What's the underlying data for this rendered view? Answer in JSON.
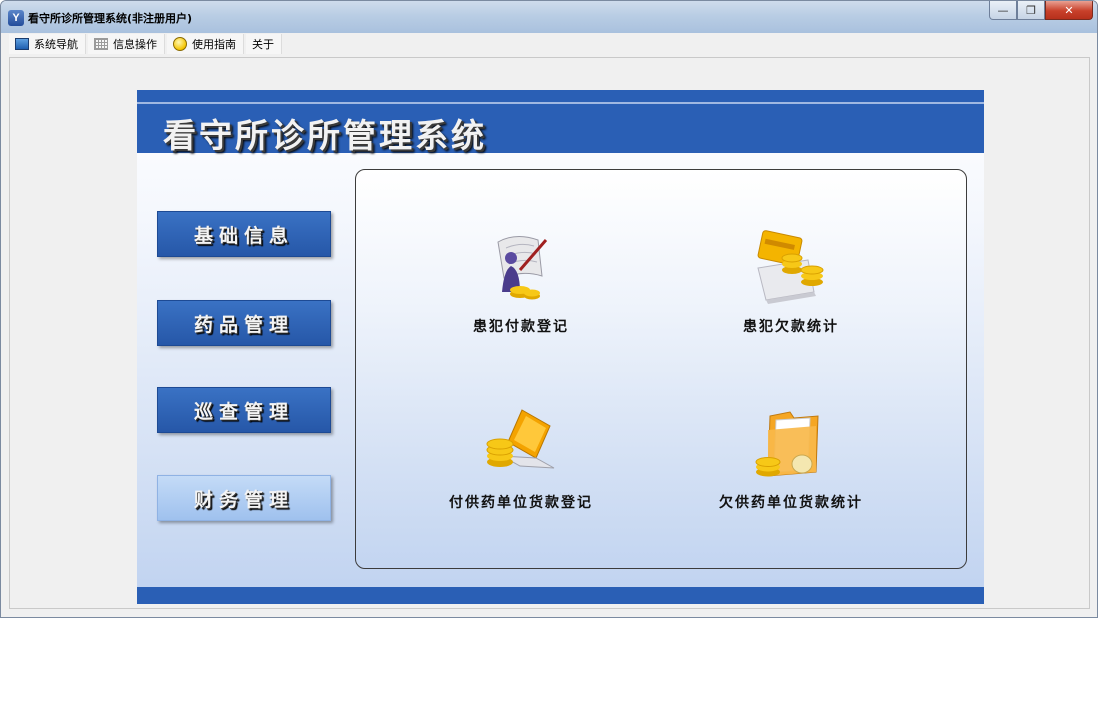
{
  "window": {
    "title": "看守所诊所管理系统(非注册用户)",
    "controls": {
      "minimize": "—",
      "restore": "❐",
      "close": "✕"
    }
  },
  "menu": [
    {
      "label": "系统导航",
      "icon": "monitor-icon"
    },
    {
      "label": "信息操作",
      "icon": "grid-icon"
    },
    {
      "label": "使用指南",
      "icon": "smiley-icon"
    },
    {
      "label": "关于",
      "icon": ""
    }
  ],
  "banner": {
    "title": "看守所诊所管理系统"
  },
  "nav": [
    {
      "label": "基础信息",
      "active": false
    },
    {
      "label": "药品管理",
      "active": false
    },
    {
      "label": "巡查管理",
      "active": false
    },
    {
      "label": "财务管理",
      "active": true
    }
  ],
  "tiles": [
    {
      "label": "患犯付款登记",
      "icon": "payment-register-icon"
    },
    {
      "label": "患犯欠款统计",
      "icon": "debt-statistics-icon"
    },
    {
      "label": "付供药单位货款登记",
      "icon": "supplier-payment-icon"
    },
    {
      "label": "欠供药单位货款统计",
      "icon": "supplier-debt-icon"
    }
  ],
  "colors": {
    "banner": "#2a5fb5",
    "nav_button": "#2a5fb5",
    "nav_active": "#a8c6ef"
  }
}
